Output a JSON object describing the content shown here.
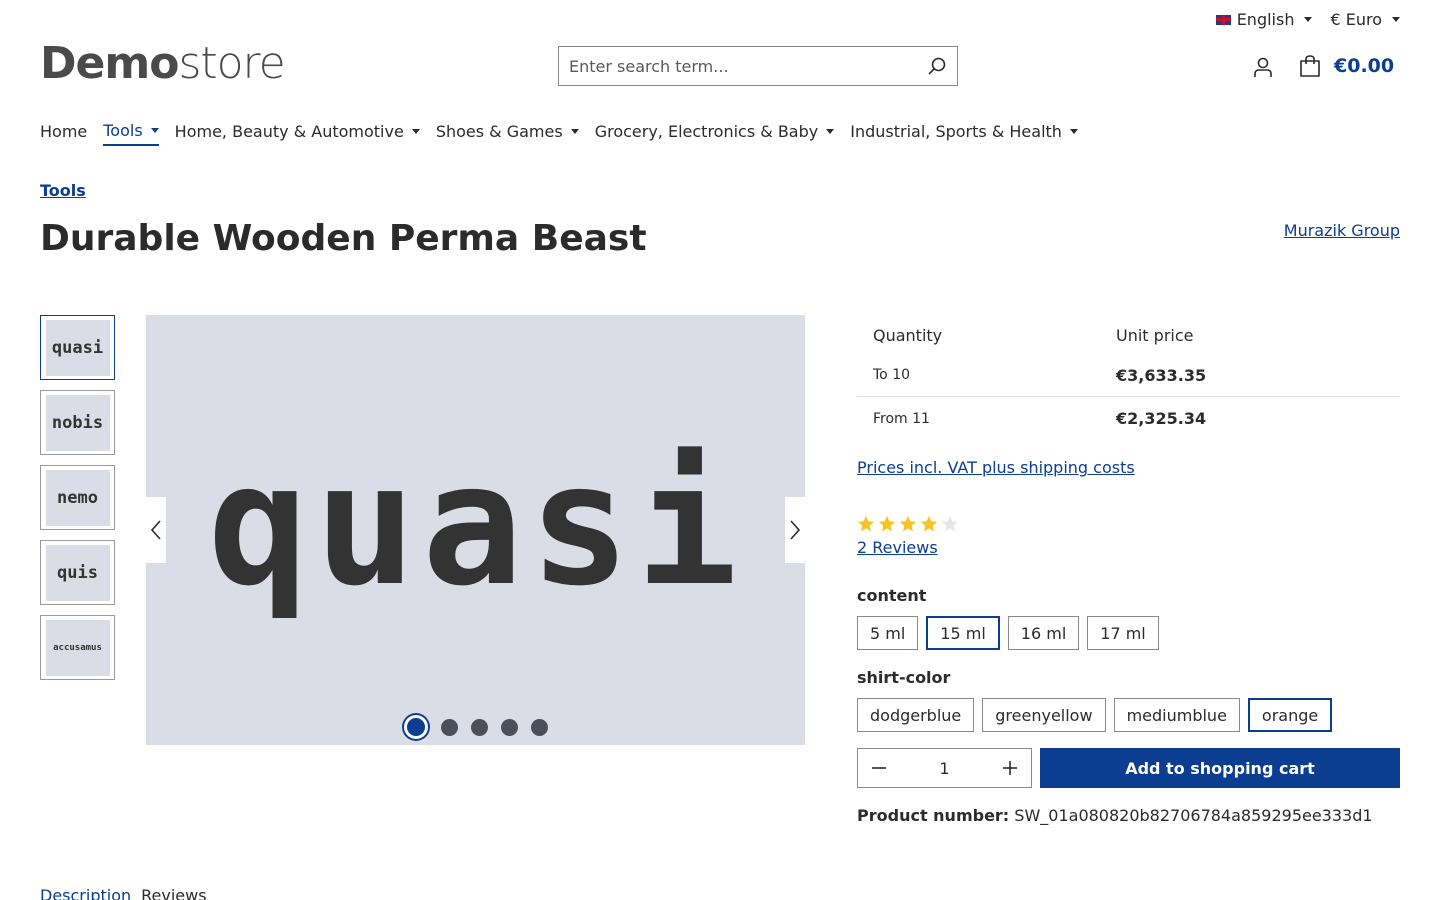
{
  "topbar": {
    "language": "English",
    "currency": "€ Euro"
  },
  "logo": {
    "bold": "Demo",
    "light": "store"
  },
  "search": {
    "placeholder": "Enter search term..."
  },
  "cart": {
    "amount": "€0.00"
  },
  "nav": {
    "items": [
      {
        "label": "Home",
        "has_dropdown": false
      },
      {
        "label": "Tools",
        "has_dropdown": true,
        "active": true
      },
      {
        "label": "Home, Beauty & Automotive",
        "has_dropdown": true
      },
      {
        "label": "Shoes & Games",
        "has_dropdown": true
      },
      {
        "label": "Grocery, Electronics & Baby",
        "has_dropdown": true
      },
      {
        "label": "Industrial, Sports & Health",
        "has_dropdown": true
      }
    ]
  },
  "breadcrumb": "Tools",
  "product": {
    "title": "Durable Wooden Perma Beast",
    "manufacturer": "Murazik Group",
    "number_label": "Product number:",
    "number": "SW_01a080820b82706784a859295ee333d1"
  },
  "gallery": {
    "thumbnails": [
      "quasi",
      "nobis",
      "nemo",
      "quis",
      "accusamus"
    ],
    "main_word": "quasi",
    "active_index": 0
  },
  "price_table": {
    "headers": [
      "Quantity",
      "Unit price"
    ],
    "rows": [
      {
        "quantity": "To 10",
        "price": "€3,633.35"
      },
      {
        "quantity": "From 11",
        "price": "€2,325.34"
      }
    ]
  },
  "vat_link": "Prices incl. VAT plus shipping costs",
  "rating": {
    "value": 4,
    "max": 5,
    "reviews_label": "2 Reviews"
  },
  "options": {
    "content": {
      "label": "content",
      "values": [
        "5 ml",
        "15 ml",
        "16 ml",
        "17 ml"
      ],
      "selected": "15 ml"
    },
    "shirt_color": {
      "label": "shirt-color",
      "values": [
        "dodgerblue",
        "greenyellow",
        "mediumblue",
        "orange"
      ],
      "selected": "orange"
    }
  },
  "quantity": "1",
  "add_to_cart": "Add to shopping cart",
  "tabs": [
    "Description",
    "Reviews"
  ],
  "colors": {
    "primary": "#0b3d91",
    "star": "#f7c325",
    "star_empty": "#e6e6e6",
    "gallery_bg": "#dadde5"
  }
}
